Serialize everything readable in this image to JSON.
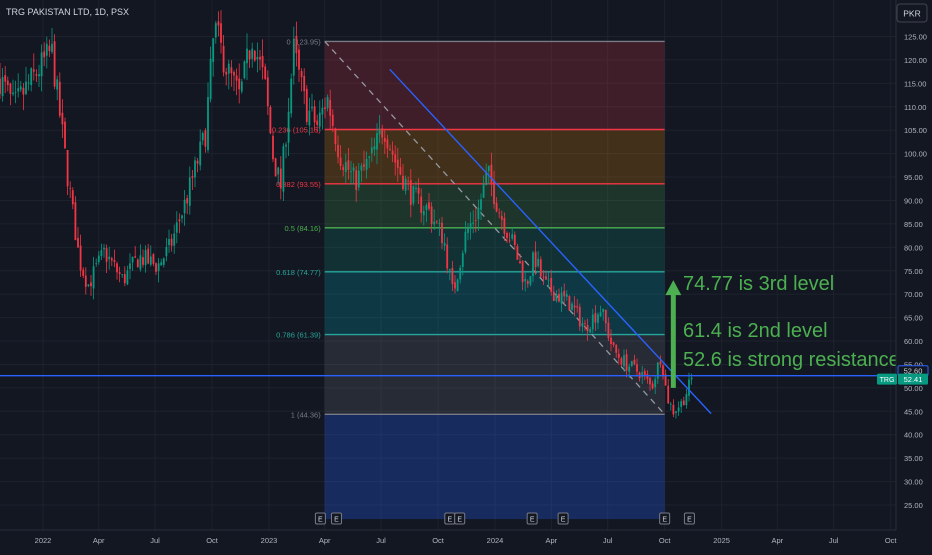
{
  "header": {
    "symbol_title": "TRG PAKISTAN LTD, 1D, PSX"
  },
  "currency_badge": "PKR",
  "colors": {
    "background": "#131722",
    "grid": "#1e222d",
    "axis_text": "#b2b5be",
    "candle_up": "#089981",
    "candle_down": "#f23645",
    "trend_line": "#2962ff",
    "annotation": "#4caf50"
  },
  "chart_data": {
    "type": "candlestick",
    "title": "TRG PAKISTAN LTD, 1D, PSX",
    "ylim": [
      22,
      131
    ],
    "y_ticks": [
      "125.00",
      "120.00",
      "115.00",
      "110.00",
      "105.00",
      "100.00",
      "95.00",
      "90.00",
      "85.00",
      "80.00",
      "75.00",
      "70.00",
      "65.00",
      "60.00",
      "55.00",
      "50.00",
      "45.00",
      "40.00",
      "35.00",
      "30.00",
      "25.00"
    ],
    "x_ticks": [
      "2022",
      "Apr",
      "Jul",
      "Oct",
      "2023",
      "Apr",
      "Jul",
      "Oct",
      "2024",
      "Apr",
      "Jul",
      "Oct",
      "2025",
      "Apr",
      "Jul",
      "Oct"
    ],
    "price_path": [
      {
        "date": "2021-10-01",
        "price": 122
      },
      {
        "date": "2021-11-15",
        "price": 110
      },
      {
        "date": "2021-12-20",
        "price": 117
      },
      {
        "date": "2022-01-15",
        "price": 122
      },
      {
        "date": "2022-02-10",
        "price": 95
      },
      {
        "date": "2022-03-01",
        "price": 77
      },
      {
        "date": "2022-03-15",
        "price": 72
      },
      {
        "date": "2022-04-10",
        "price": 79
      },
      {
        "date": "2022-05-10",
        "price": 73
      },
      {
        "date": "2022-06-05",
        "price": 78
      },
      {
        "date": "2022-07-05",
        "price": 76
      },
      {
        "date": "2022-07-25",
        "price": 80
      },
      {
        "date": "2022-08-20",
        "price": 90
      },
      {
        "date": "2022-09-20",
        "price": 104
      },
      {
        "date": "2022-10-05",
        "price": 127
      },
      {
        "date": "2022-10-25",
        "price": 118
      },
      {
        "date": "2022-11-15",
        "price": 112
      },
      {
        "date": "2022-12-05",
        "price": 125
      },
      {
        "date": "2022-12-25",
        "price": 115
      },
      {
        "date": "2023-01-08",
        "price": 99
      },
      {
        "date": "2023-01-20",
        "price": 93
      },
      {
        "date": "2023-02-10",
        "price": 122
      },
      {
        "date": "2023-03-01",
        "price": 110
      },
      {
        "date": "2023-03-20",
        "price": 106
      },
      {
        "date": "2023-04-05",
        "price": 112
      },
      {
        "date": "2023-04-25",
        "price": 100
      },
      {
        "date": "2023-05-20",
        "price": 94
      },
      {
        "date": "2023-06-15",
        "price": 99
      },
      {
        "date": "2023-07-05",
        "price": 106
      },
      {
        "date": "2023-07-25",
        "price": 98
      },
      {
        "date": "2023-08-20",
        "price": 91
      },
      {
        "date": "2023-09-15",
        "price": 88
      },
      {
        "date": "2023-10-10",
        "price": 82
      },
      {
        "date": "2023-10-25",
        "price": 70
      },
      {
        "date": "2023-11-15",
        "price": 83
      },
      {
        "date": "2023-12-05",
        "price": 88
      },
      {
        "date": "2023-12-20",
        "price": 96
      },
      {
        "date": "2024-01-10",
        "price": 87
      },
      {
        "date": "2024-02-01",
        "price": 80
      },
      {
        "date": "2024-02-20",
        "price": 72
      },
      {
        "date": "2024-03-05",
        "price": 78
      },
      {
        "date": "2024-03-20",
        "price": 72
      },
      {
        "date": "2024-04-10",
        "price": 70
      },
      {
        "date": "2024-05-01",
        "price": 68
      },
      {
        "date": "2024-05-25",
        "price": 63
      },
      {
        "date": "2024-06-20",
        "price": 67
      },
      {
        "date": "2024-07-10",
        "price": 58
      },
      {
        "date": "2024-08-01",
        "price": 55
      },
      {
        "date": "2024-08-25",
        "price": 53
      },
      {
        "date": "2024-09-10",
        "price": 50
      },
      {
        "date": "2024-09-25",
        "price": 57
      },
      {
        "date": "2024-10-05",
        "price": 48
      },
      {
        "date": "2024-10-15",
        "price": 45
      },
      {
        "date": "2024-10-30",
        "price": 47
      },
      {
        "date": "2024-11-15",
        "price": 52.41
      }
    ],
    "fibonacci": {
      "range_start": "2023-04-01",
      "range_end": "2024-10-01",
      "levels": [
        {
          "ratio": "0",
          "price": 123.95,
          "label": "0 (123.95)",
          "line_color": "#787b86",
          "band_color": "#f23645"
        },
        {
          "ratio": "0.236",
          "price": 105.15,
          "label": "0.236 (105.15)",
          "line_color": "#f23645",
          "band_color": "#ff9800"
        },
        {
          "ratio": "0.382",
          "price": 93.55,
          "label": "0.382 (93.55)",
          "line_color": "#f23645",
          "band_color": "#4caf50"
        },
        {
          "ratio": "0.5",
          "price": 84.16,
          "label": "0.5 (84.16)",
          "line_color": "#4caf50",
          "band_color": "#089981"
        },
        {
          "ratio": "0.618",
          "price": 74.77,
          "label": "0.618 (74.77)",
          "line_color": "#26a69a",
          "band_color": "#00bcd4"
        },
        {
          "ratio": "0.786",
          "price": 61.39,
          "label": "0.786 (61.39)",
          "line_color": "#26a69a",
          "band_color": "#787b86"
        },
        {
          "ratio": "1",
          "price": 44.36,
          "label": "1 (44.36)",
          "line_color": "#787b86",
          "band_color": "#2962ff"
        }
      ],
      "extension_bottom_price": 22,
      "diagonal": {
        "from_date": "2023-04-01",
        "from_price": 123.95,
        "to_date": "2024-10-01",
        "to_price": 44.36
      }
    },
    "trend_line": {
      "from_date": "2023-07-15",
      "from_price": 118,
      "to_date": "2024-12-15",
      "to_price": 44.5
    },
    "horizontal_line": {
      "price": 52.6
    },
    "annotations": [
      "74.77 is 3rd level",
      "61.4 is 2nd level",
      "52.6 is strong resistance"
    ],
    "arrow": {
      "date": "2024-10-15",
      "from_price": 50,
      "to_price": 73
    },
    "price_labels": [
      {
        "text": "52.60",
        "price": 52.6,
        "style": "line"
      },
      {
        "text": "52.41",
        "price": 52.41,
        "style": "last"
      },
      {
        "text": "TRG",
        "price": 52.41,
        "style": "ticker"
      }
    ],
    "earnings_dates": [
      "2023-03-25",
      "2023-04-20",
      "2023-10-20",
      "2023-11-05",
      "2024-03-01",
      "2024-04-20",
      "2024-10-01",
      "2024-11-10"
    ],
    "earnings_marker_label": "E"
  }
}
